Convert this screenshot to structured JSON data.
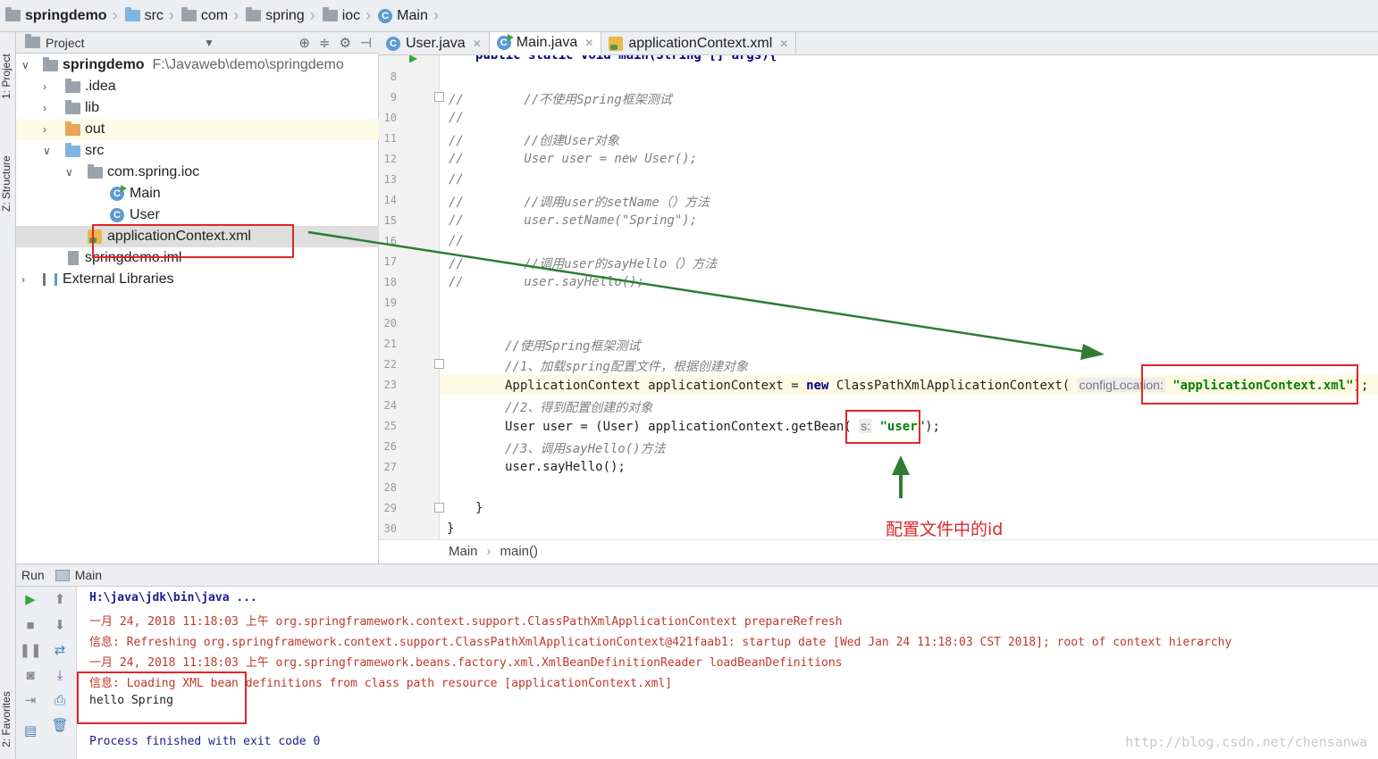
{
  "breadcrumb": [
    {
      "label": "springdemo",
      "icon": "module-folder-icon"
    },
    {
      "label": "src",
      "icon": "folder-icon"
    },
    {
      "label": "com",
      "icon": "folder-icon"
    },
    {
      "label": "spring",
      "icon": "folder-icon"
    },
    {
      "label": "ioc",
      "icon": "folder-icon"
    },
    {
      "label": "Main",
      "icon": "class-icon"
    }
  ],
  "side_tabs": {
    "project": "1: Project",
    "structure": "Z: Structure",
    "favorites": "2: Favorites"
  },
  "project_panel": {
    "title": "Project",
    "tree": [
      {
        "label": "springdemo",
        "path": "F:\\Javaweb\\demo\\springdemo"
      },
      {
        "label": ".idea"
      },
      {
        "label": "lib"
      },
      {
        "label": "out"
      },
      {
        "label": "src"
      },
      {
        "label": "com.spring.ioc"
      },
      {
        "label": "Main"
      },
      {
        "label": "User"
      },
      {
        "label": "applicationContext.xml"
      },
      {
        "label": "springdemo.iml"
      },
      {
        "label": "External Libraries"
      }
    ]
  },
  "editor_tabs": [
    {
      "label": "User.java",
      "active": false
    },
    {
      "label": "Main.java",
      "active": true
    },
    {
      "label": "applicationContext.xml",
      "active": false
    }
  ],
  "editor": {
    "line_numbers": [
      "8",
      "9",
      "10",
      "11",
      "12",
      "13",
      "14",
      "15",
      "16",
      "17",
      "18",
      "19",
      "20",
      "21",
      "22",
      "23",
      "24",
      "25",
      "26",
      "27",
      "28",
      "29",
      "30"
    ],
    "lines": {
      "l7": "public static void main(String [] args){",
      "l9": "//        //不使用Spring框架测试",
      "l10": "//",
      "l11": "//        //创建User对象",
      "l12": "//        User user = new User();",
      "l13": "//",
      "l14": "//        //调用user的setName（）方法",
      "l15": "//        user.setName(\"Spring\");",
      "l16": "//",
      "l17": "//        //调用user的sayHello（）方法",
      "l18": "//        user.sayHello();",
      "l21": "//使用Spring框架测试",
      "l22": "//1、加载spring配置文件，根据创建对象",
      "l23_a": "ApplicationContext applicationContext = ",
      "l23_kw": "new",
      "l23_b": " ClassPathXmlApplicationContext(",
      "l23_hint": "configLocation:",
      "l23_str": "\"applicationContext.xml\"",
      "l23_end": ");",
      "l24": "//2、得到配置创建的对象",
      "l25_a": "User user = (User) applicationContext.getBean(",
      "l25_hint": "s:",
      "l25_str": "\"user\"",
      "l25_end": ");",
      "l26": "//3、调用sayHello()方法",
      "l27": "user.sayHello();",
      "l29": "}",
      "l30": "}"
    },
    "footer": {
      "class": "Main",
      "method": "main()"
    }
  },
  "run_panel": {
    "label": "Run",
    "tab": "Main",
    "console": [
      {
        "text": "H:\\java\\jdk\\bin\\java ...",
        "style": "cmd"
      },
      {
        "text": "一月 24, 2018 11:18:03 上午 org.springframework.context.support.ClassPathXmlApplicationContext prepareRefresh",
        "style": "red"
      },
      {
        "text": "信息: Refreshing org.springframework.context.support.ClassPathXmlApplicationContext@421faab1: startup date [Wed Jan 24 11:18:03 CST 2018]; root of context hierarchy",
        "style": "red"
      },
      {
        "text": "一月 24, 2018 11:18:03 上午 org.springframework.beans.factory.xml.XmlBeanDefinitionReader loadBeanDefinitions",
        "style": "red"
      },
      {
        "text": "信息: Loading XML bean definitions from class path resource [applicationContext.xml]",
        "style": "red"
      },
      {
        "text": "hello Spring",
        "style": "dark"
      },
      {
        "text": "",
        "style": "dark"
      },
      {
        "text": "Process finished with exit code 0",
        "style": "blue"
      }
    ]
  },
  "annotation": {
    "label": "配置文件中的id",
    "color": "#e0252b",
    "arrow_color": "#2e7d32"
  },
  "watermark": "http://blog.csdn.net/chensanwa"
}
